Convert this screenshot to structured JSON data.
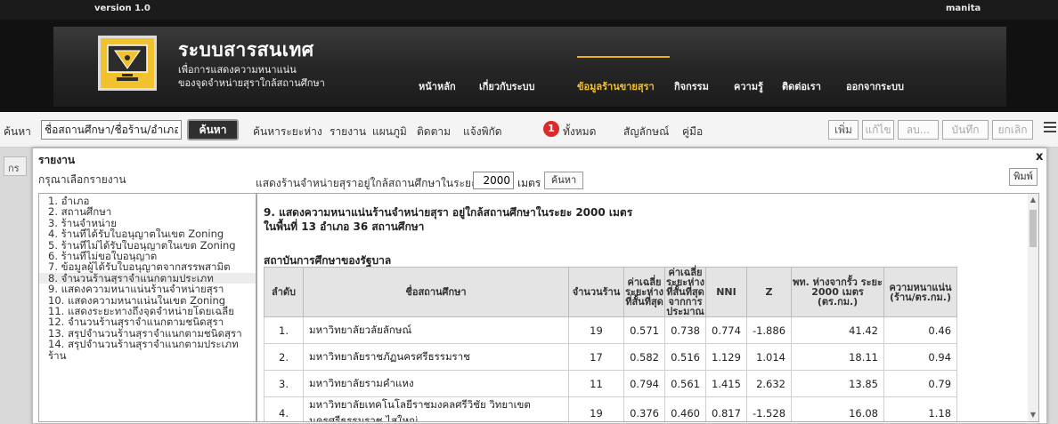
{
  "topbar": {
    "version": "version 1.0",
    "user": "manita"
  },
  "brand": {
    "title": "ระบบสารสนเทศ",
    "subtitle1": "เพื่อการแสดงความหนาแน่น",
    "subtitle2": "ของจุดจำหน่ายสุราใกล้สถานศึกษา",
    "logo_color": "#f2c12e"
  },
  "nav": {
    "items": [
      {
        "label": "หน้าหลัก"
      },
      {
        "label": "เกี่ยวกับระบบ"
      },
      {
        "label": "ข้อมูลร้านขายสุรา"
      },
      {
        "label": "กิจกรรม"
      },
      {
        "label": "ความรู้"
      },
      {
        "label": "ติดต่อเรา"
      },
      {
        "label": "ออกจากระบบ"
      }
    ],
    "active_index": 2,
    "active_color": "#f2c12e"
  },
  "toolbar": {
    "search_label": "ค้นหา",
    "search_value": "ชื่อสถานศึกษา/ชื่อร้าน/อำเภอ",
    "search_button": "ค้นหา",
    "links": [
      "ค้นหาระยะห่าง",
      "รายงาน",
      "แผนภูมิ",
      "ติดตาม",
      "แจ้งพิกัด"
    ],
    "badge_count": "1",
    "all_label": "ทั้งหมด",
    "links2": [
      "สัญลักษณ์",
      "คู่มือ"
    ],
    "buttons": [
      "เพิ่ม",
      "แก้ไข",
      "ลบ...",
      "บันทึก",
      "ยกเลิก"
    ],
    "badge_color": "#d92b2b"
  },
  "map_tab_label": "กร",
  "modal": {
    "title": "รายงาน",
    "close": "x",
    "prompt": "กรุณาเลือกรายงาน",
    "print_button": "พิมพ์",
    "radius_label": "แสดงร้านจำหน่ายสุราอยู่ใกล้สถานศึกษาในระยะ",
    "radius_value": "2000",
    "radius_unit": "เมตร",
    "radius_button": "ค้นหา",
    "reports": [
      "1. อำเภอ",
      "2. สถานศึกษา",
      "3. ร้านจำหน่าย",
      "4. ร้านที่ได้รับใบอนุญาตในเขต Zoning",
      "5. ร้านที่ไม่ได้รับใบอนุญาตในเขต Zoning",
      "6. ร้านที่ไม่ขอใบอนุญาต",
      "7. ข้อมูลผู้ได้รับใบอนุญาตจากสรรพสามิต",
      "8. จำนวนร้านสุราจำแนกตามประเภท",
      "9. แสดงความหนาแน่นร้านจำหน่ายสุรา",
      "10. แสดงความหนาแน่นในเขต Zoning",
      "11. แสดงระยะทางถึงจุดจำหน่ายโดยเฉลี่ย",
      "12. จำนวนร้านสุราจำแนกตามชนิดสุรา",
      "13. สรุปจำนวนร้านสุราจำแนกตามชนิดสุรา",
      "14. สรุปจำนวนร้านสุราจำแนกตามประเภท",
      "ร้าน"
    ],
    "selected_index": 7
  },
  "report": {
    "heading": "9. แสดงความหนาแน่นร้านจำหน่ายสุรา อยู่ใกล้สถานศึกษาในระยะ 2000 เมตร",
    "subheading": "ในพื้นที่  13 อำเภอ  36 สถานศึกษา",
    "section": "สถาบันการศึกษาของรัฐบาล",
    "columns": [
      "ลำดับ",
      "ชื่อสถานศึกษา",
      "จำนวนร้าน",
      "ค่าเฉลี่ย ระยะห่าง ที่สั้นที่สุด",
      "ค่าเฉลี่ย ระยะห่าง ที่สั้นที่สุด จากการ ประมาณ",
      "NNI",
      "Z",
      "พท. ห่างจากรั้ว ระยะ 2000 เมตร (ตร.กม.)",
      "ความหนาแน่น (ร้าน/ตร.กม.)"
    ],
    "rows": [
      {
        "no": "1.",
        "name": "มหาวิทยาลัยวลัยลักษณ์",
        "shops": "19",
        "avg": "0.571",
        "est": "0.738",
        "nni": "0.774",
        "z": "-1.886",
        "area": "41.42",
        "density": "0.46"
      },
      {
        "no": "2.",
        "name": "มหาวิทยาลัยราชภัฏนครศรีธรรมราช",
        "shops": "17",
        "avg": "0.582",
        "est": "0.516",
        "nni": "1.129",
        "z": "1.014",
        "area": "18.11",
        "density": "0.94"
      },
      {
        "no": "3.",
        "name": "มหาวิทยาลัยรามคำแหง",
        "shops": "11",
        "avg": "0.794",
        "est": "0.561",
        "nni": "1.415",
        "z": "2.632",
        "area": "13.85",
        "density": "0.79"
      },
      {
        "no": "4.",
        "name": "มหาวิทยาลัยเทคโนโลยีราชมงคลศรีวิชัย วิทยาเขต",
        "name2": "นครศรีธรรมราช ไสใหญ่",
        "shops": "19",
        "avg": "0.376",
        "est": "0.460",
        "nni": "0.817",
        "z": "-1.528",
        "area": "16.08",
        "density": "1.18"
      }
    ]
  }
}
